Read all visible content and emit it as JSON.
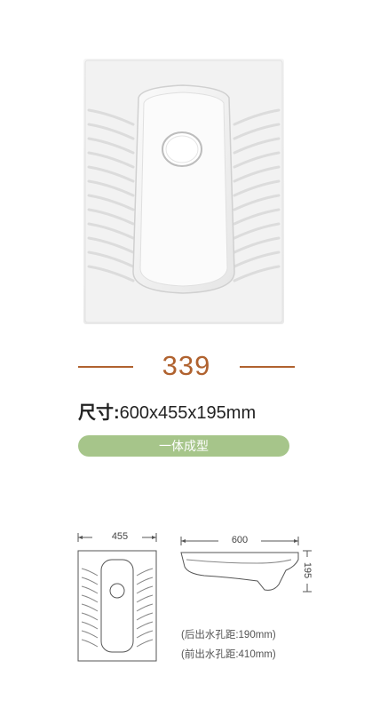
{
  "product": {
    "model_number": "339",
    "size_label": "尺寸:",
    "size_value": "600x455x195mm",
    "feature": "一体成型"
  },
  "drawing": {
    "top_view_width": "455",
    "side_view_length": "600",
    "side_view_height": "195",
    "rear_outlet_note": "(后出水孔距:190mm)",
    "front_outlet_note": "(前出水孔距:410mm)"
  },
  "colors": {
    "accent_brown": "#b0622f",
    "pill_green": "#a6c58a"
  }
}
